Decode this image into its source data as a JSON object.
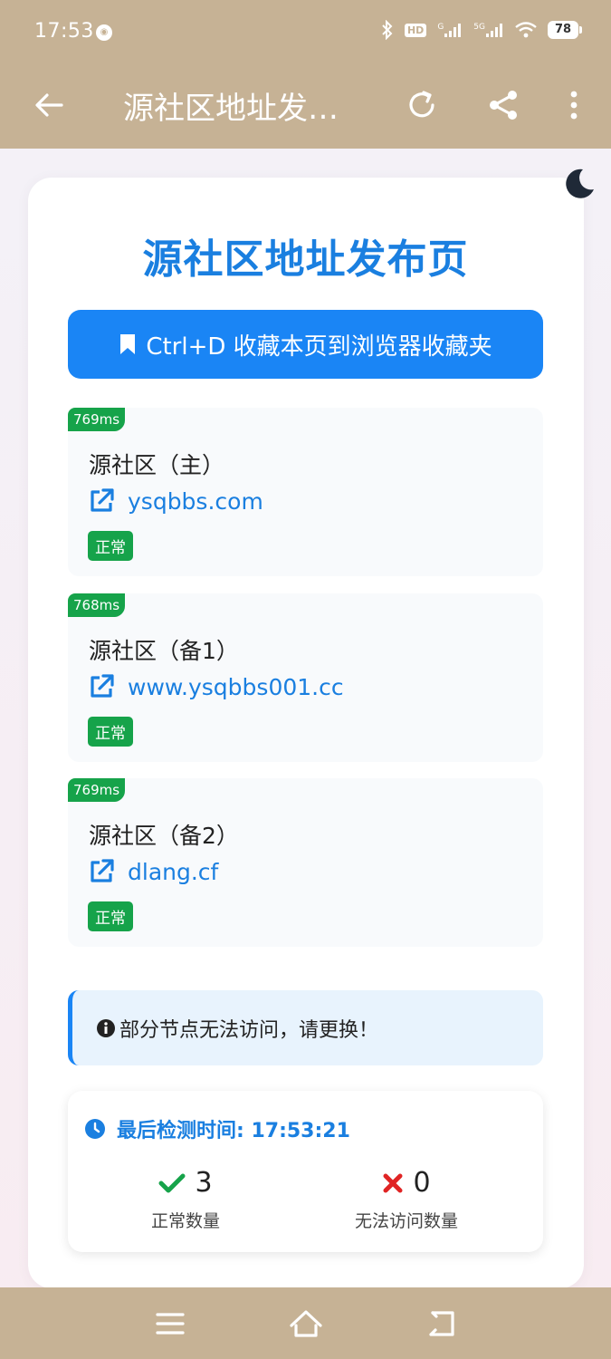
{
  "status_bar": {
    "time": "17:53",
    "hd": "HD",
    "signal_1": "G",
    "signal_2": "5G",
    "battery": "78"
  },
  "app_bar": {
    "title": "源社区地址发…"
  },
  "page": {
    "title": "源社区地址发布页",
    "bookmark_label": "Ctrl+D 收藏本页到浏览器收藏夹"
  },
  "nodes": [
    {
      "latency": "769ms",
      "name": "源社区（主）",
      "url": "ysqbbs.com",
      "status": "正常"
    },
    {
      "latency": "768ms",
      "name": "源社区（备1）",
      "url": "www.ysqbbs001.cc",
      "status": "正常"
    },
    {
      "latency": "769ms",
      "name": "源社区（备2）",
      "url": "dlang.cf",
      "status": "正常"
    }
  ],
  "notice": {
    "text": "部分节点无法访问，请更换！"
  },
  "stats": {
    "last_check": "最后检测时间: 17:53:21",
    "ok_count": "3",
    "ok_label": "正常数量",
    "fail_count": "0",
    "fail_label": "无法访问数量"
  },
  "colors": {
    "system_bar": "#c6b295",
    "accent": "#1a85f5",
    "title_blue": "#1a7fe0",
    "success": "#16a34a",
    "error": "#e02424"
  },
  "icons": [
    "back-arrow-icon",
    "reload-icon",
    "share-icon",
    "more-vert-icon",
    "moon-icon",
    "bookmark-icon",
    "external-link-icon",
    "info-circle-icon",
    "clock-icon",
    "check-icon",
    "x-icon",
    "menu-icon",
    "home-icon",
    "nav-back-icon"
  ]
}
